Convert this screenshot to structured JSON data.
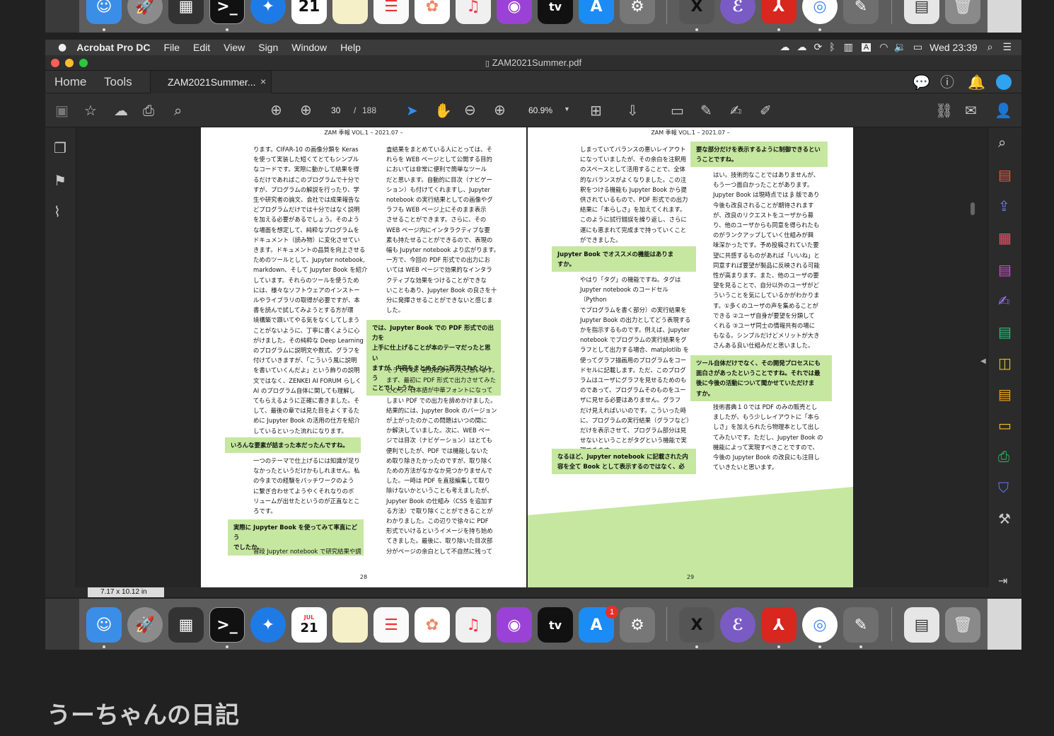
{
  "menubar": {
    "app_name": "Acrobat Pro DC",
    "menus": [
      "File",
      "Edit",
      "View",
      "Sign",
      "Window",
      "Help"
    ],
    "clock": "Wed 23:39",
    "input_indicator": "A"
  },
  "window": {
    "title": "ZAM2021Summer.pdf",
    "tabs": {
      "home": "Home",
      "tools": "Tools",
      "document": "ZAM2021Summer...",
      "close": "×"
    }
  },
  "toolbar": {
    "current_page": "30",
    "page_separator": "/",
    "total_pages": "188",
    "zoom": "60.9%"
  },
  "dock": {
    "calendar_month": "JUL",
    "calendar_day": "21",
    "appstore_badge": "1",
    "tv_label": "tv"
  },
  "pages": {
    "header": "ZAM 季報 VOL.1 – 2021.07 –",
    "left": {
      "number": "28",
      "col1": "ります。CIFAR-10 の画像分類を Keras\nを使って実装した短くてとてもシンプル\nなコードです。実際に動かして結果を得\nるだけであればこのプログラムで十分で\nすが、プログラムの解説を行ったり、学\n生や研究者の論文、会社では成果報告な\nどプログラムだけでは十分ではなく説明\nを加える必要があるでしょう。そのよう\nな場面を想定して、純粋なプログラムを\nドキュメント（読み物）に変化させてい\nきます。ドキュメントの品質を向上させる\nためのツールとして、Jupyter notebook,\nmarkdown、そして Jupyter Book を紹介\nしています。それらのツールを使うため\nには、様々なソフトウェアのインストー\nルやライブラリの取得が必要ですが、本\n書を読んで試してみようとする方が環\n境構築で躓いてやる気をなくしてしまう\nことがないように、丁寧に書くように心\nがけました。その純粋な Deep Learning\nのプログラムに説明文や数式、グラフを\n付けていきますが、「こういう風に説明\nを書いていくんだよ」という飾りの説明\n文ではなく、ZENKEI AI FORUM らしく\nAI のプログラム自体に関しても理解し\nてもらえるように正確に書きました。そ\nして、最後の章では見た目をよくするた\nめに Jupyter Book の活用の仕方を紹介\nしているといった流れになります。",
      "q1": "いろんな要素が詰まった本だったんですね。",
      "col1b": "一つのテーマで仕上げるには知識が足り\nなかったというだけかもしれません。私\nの今までの経験をパッチワークのよう\nに繋ぎ合わせてようやくそれなりのボ\nリュームが出せたというのが正直なとこ\nろです。",
      "q2": "実際に Jupyter Book を使ってみて率直にどう\nでしたか。",
      "col1c": "普段 Jupyter notebook で研究結果や調",
      "col2": "査結果をまとめている人にとっては、そ\nれらを WEB ページとして公開する目的\nにおいては非常に便利で簡単なツール\nだと思います。自動的に目次（ナビゲー\nション）も付けてくれますし、Jupyter\nnotebook の実行結果としての画像やグ\nラフも WEB ページ上にそのまま表示\nさせることができます。さらに、その\nWEB ページ内にインタラクティブな要\n素も持たせることができるので、表現の\n幅も Jupyter notebook より広がります。\n一方で、今回の PDF 形式での出力にお\nいては WEB ページで効果的なインタラ\nクティブな効果をつけることができな\nいこともあり、Jupyter Book の良さを十\n分に発揮させることができないと感じま\nした。",
      "q3": "では、Jupyter Book での PDF 形式での出力を\n上手に仕上げることが本のテーマだったと思い\nますが、内容をまとめるのに苦労されたという\nことでしょうか。",
      "col2b": "そうですね、苦労は多かったと思います。\nまず、最初に PDF 形式で出力させてみた\nところ、日本語が中華フォントになって\nしまい PDF での出力を諦めかけました。\n結果的には、Jupyter Book のバージョン\nが上がったのかこの問題はいつの間に\nか解決していました。次に、WEB ペー\nジでは目次（ナビゲーション）はとても\n便利でしたが、PDF では機能しないた\nめ取り除きたかったのですが、取り除く\nための方法がなかなか見つかりませんで\nした。一時は PDF を直接編集して取り\n除けないかということも考えましたが、\nJupyter Book の仕組み（CSS を追加す\nる方法）で取り除くことができることが\nわかりました。この辺りで徐々に PDF\n形式でいけるというイメージを持ち始め\nてきました。最後に、取り除いた目次部\n分がページの余白として不自然に残って"
    },
    "right": {
      "number": "29",
      "col1": "しまっていてバランスの悪いレイアウト\nになっていましたが、その余白を注釈用\nのスペースとして活用することで、全体\n的なバランスがよくなりました。この注\n釈をつける機能も Jupyter Book から提\n供されているもので、PDF 形式での出力\n結果に「本らしさ」を加えてくれます。\nこのように試行錯誤を繰り返し、さらに\n運にも恵まれて完成まで持っていくこと\nができました。",
      "q1": "Jupyter Book でオススメの機能はありま\nすか。",
      "col1b": "やはり「タグ」の機能ですね。タグは\nJupyter notebook のコードセル（Python\nでプログラムを書く部分）の実行結果を\nJupyter Book の出力としてどう表現する\nかを指示するものです。例えば、Jupyter\nnotebook でプログラムの実行結果をグ\nラフとして出力する場合、matplotlib を\n使ってグラフ描画用のプログラムをコー\nドセルに記載します。ただ、このプログ\nラムはユーザにグラフを見せるためのも\nのであって、プログラムそのものをユー\nザに見せる必要はありません。グラフ\nだけ見えればいいのです。こういった時\nに、プログラムの実行結果（グラフなど）\nだけを表示させて、プログラム部分は見\nせないということがタグという機能で実\n現できます。",
      "q2": "なるほど、Jupyter notebook に記載された内\n容を全て Book として表示するのではなく、必",
      "q3": "要な部分だけを表示するように制御できるとい\nうことですね。",
      "col2": "はい。技術的なことではありませんが、\nもう一つ面白かったことがあります。\nJupyter Book は現時点では β 版であり\n今後も改良されることが期待されます\nが、改良のリクエストをユーザから募\nり、他のユーザからも同意を得られたも\nのがランクアップしていく仕組みが興\n味深かったです。予め投稿されていた要\n望に共感するものがあれば「いいね」と\n同意すれば要望が製品に反映される可能\n性が高まります。また、他のユーザの要\n望を見ることで、自分以外のユーザがど\nういうことを気にしているかがわかりま\nす。①多くのユーザの声を集めることが\nできる ②ユーザ自身が要望を分類して\nくれる ③ユーザ同士の情報共有の場に\nもなる。シンプルだけどメリットが大き\nさんある良い仕組みだと思いました。",
      "q4": "ツール自体だけでなく、その開発プロセスにも\n面白さがあったということですね。それでは最\n後に今後の活動について聞かせていただけま\nすか。",
      "col2b": "技術書典１０では PDF のみの販売とし\nましたが、もう少しレイアウトに「本ら\nしさ」を加えられたら物理本として出し\nてみたいです。ただし、Jupyter Book の\n機能によって実現すべきことですので、\n今後の Jupyter Book の改良にも注目し\nていきたいと思います。"
    }
  },
  "status_bar": {
    "page_size": "7.17 x 10.12 in"
  },
  "blog_title": "うーちゃんの日記",
  "colors": {
    "highlight": "#c6e7a0",
    "acrobat_red": "#d7271f",
    "accent_blue": "#2ea3f2"
  }
}
